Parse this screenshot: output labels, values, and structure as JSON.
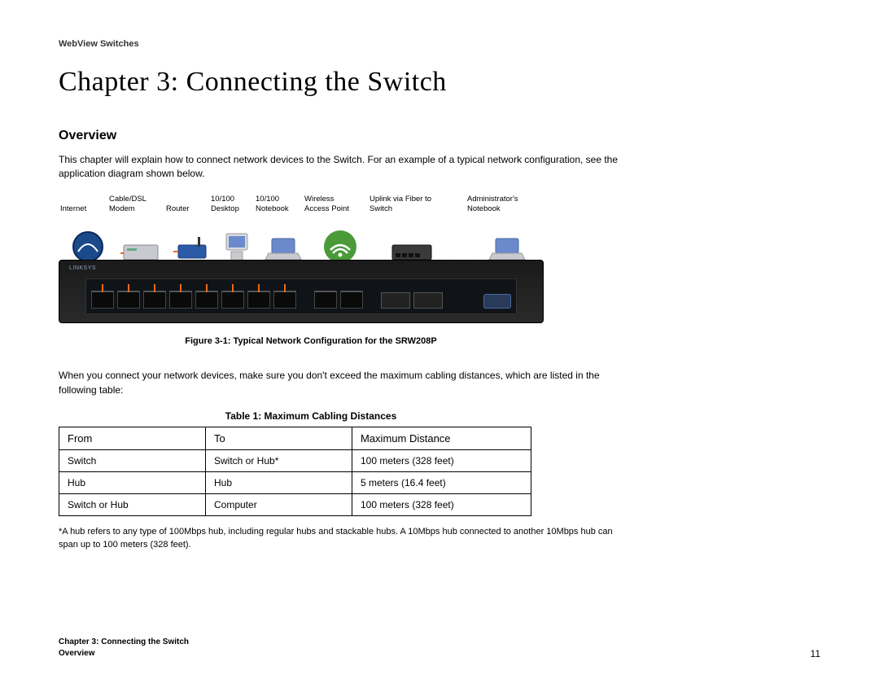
{
  "header": "WebView Switches",
  "chapter_title": "Chapter 3: Connecting the Switch",
  "section_heading": "Overview",
  "intro": "This chapter will explain how to connect network devices to the Switch. For an example of a typical network configuration, see the application diagram shown below.",
  "diagram_labels": [
    {
      "line1": "",
      "line2": "Internet"
    },
    {
      "line1": "Cable/DSL",
      "line2": "Modem"
    },
    {
      "line1": "",
      "line2": "Router"
    },
    {
      "line1": "10/100",
      "line2": "Desktop"
    },
    {
      "line1": "10/100",
      "line2": "Notebook"
    },
    {
      "line1": "Wireless",
      "line2": "Access Point"
    },
    {
      "line1": "Uplink via Fiber to",
      "line2": "Switch"
    },
    {
      "line1": "Administrator's",
      "line2": "Notebook"
    }
  ],
  "switch_brand": "LINKSYS",
  "figure_caption": "Figure 3-1: Typical Network Configuration for the SRW208P",
  "after_figure": "When you connect your network devices, make sure you don't exceed the maximum cabling distances, which are listed in the following table:",
  "table_title": "Table 1: Maximum Cabling Distances",
  "table": {
    "headers": [
      "From",
      "To",
      "Maximum Distance"
    ],
    "rows": [
      [
        "Switch",
        "Switch or Hub*",
        "100 meters (328 feet)"
      ],
      [
        "Hub",
        "Hub",
        "5 meters (16.4 feet)"
      ],
      [
        "Switch or Hub",
        "Computer",
        "100 meters (328 feet)"
      ]
    ]
  },
  "footnote": "*A hub refers to any type of 100Mbps hub, including regular hubs and stackable hubs. A 10Mbps hub connected to another 10Mbps hub can span up to 100 meters (328 feet).",
  "footer": {
    "chapter": "Chapter 3: Connecting the Switch",
    "section": "Overview",
    "page": "11"
  }
}
